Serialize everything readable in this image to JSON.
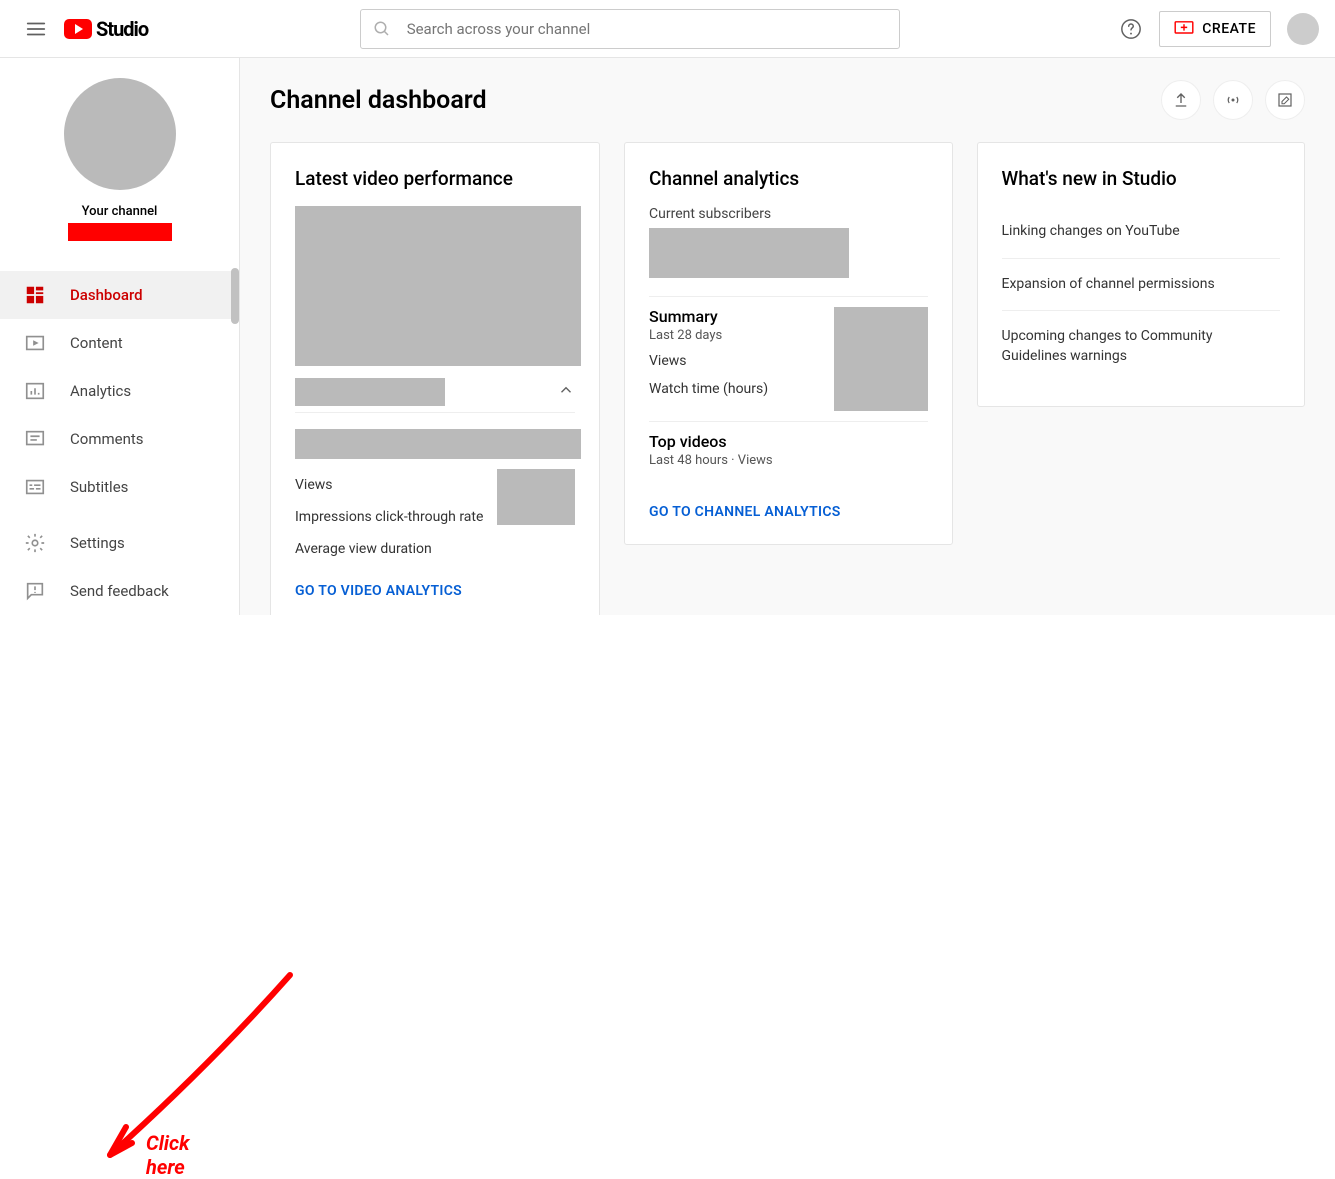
{
  "header": {
    "logo_text": "Studio",
    "search_placeholder": "Search across your channel",
    "create_label": "CREATE"
  },
  "sidebar": {
    "channel_label": "Your channel",
    "items": [
      {
        "label": "Dashboard"
      },
      {
        "label": "Content"
      },
      {
        "label": "Analytics"
      },
      {
        "label": "Comments"
      },
      {
        "label": "Subtitles"
      }
    ],
    "bottom": [
      {
        "label": "Settings"
      },
      {
        "label": "Send feedback"
      }
    ]
  },
  "main": {
    "title": "Channel dashboard"
  },
  "latest_video": {
    "title": "Latest video performance",
    "stats": {
      "views": "Views",
      "ctr": "Impressions click-through rate",
      "avd": "Average view duration"
    },
    "link": "GO TO VIDEO ANALYTICS"
  },
  "analytics": {
    "title": "Channel analytics",
    "subscribers_label": "Current subscribers",
    "summary_title": "Summary",
    "summary_sub": "Last 28 days",
    "views_label": "Views",
    "watch_label": "Watch time (hours)",
    "top_title": "Top videos",
    "top_sub": "Last 48 hours · Views",
    "link": "GO TO CHANNEL ANALYTICS"
  },
  "news": {
    "title": "What's new in Studio",
    "items": [
      "Linking changes on YouTube",
      "Expansion of channel permissions",
      "Upcoming changes to Community Guidelines warnings"
    ]
  },
  "annotation": {
    "text": "Click here"
  }
}
